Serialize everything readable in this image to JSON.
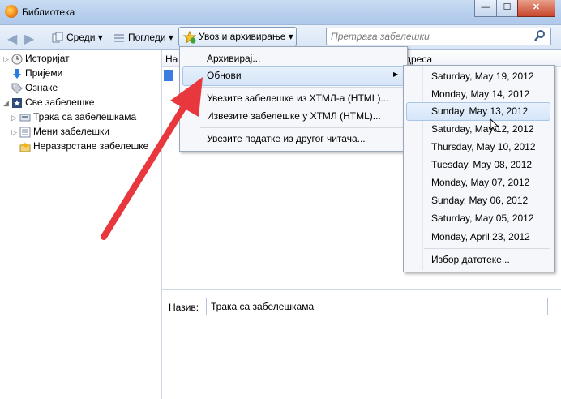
{
  "window": {
    "title": "Библиотека",
    "minimize": "—",
    "maximize": "☐",
    "close": "✕"
  },
  "toolbar": {
    "organize_label": "Среди ▾",
    "views_label": "Погледи ▾",
    "import_label": "Увоз и архивирање ▾",
    "search_placeholder": "Претрага забелешки"
  },
  "sidebar": {
    "items": [
      {
        "label": "Историјат",
        "icon": "history-icon"
      },
      {
        "label": "Пријеми",
        "icon": "downloads-icon"
      },
      {
        "label": "Ознаке",
        "icon": "tags-icon"
      },
      {
        "label": "Све забелешке",
        "icon": "all-bookmarks-icon"
      },
      {
        "label": "Трака са забелешкама",
        "icon": "bookmarks-toolbar-icon"
      },
      {
        "label": "Мени забелешки",
        "icon": "bookmarks-menu-icon"
      },
      {
        "label": "Неразврстане забелешке",
        "icon": "unsorted-bookmarks-icon"
      }
    ]
  },
  "content": {
    "column_left": "На",
    "column_right": "дреса"
  },
  "details": {
    "name_label": "Назив:",
    "name_value": "Трака са забелешкама"
  },
  "import_menu": {
    "backup": "Архивирај...",
    "restore": "Обнови",
    "import_html": "Увезите забелешке из ХТМЛ-а (HTML)...",
    "export_html": "Извезите забелешке у ХТМЛ (HTML)...",
    "import_other": "Увезите податке из другог читача..."
  },
  "restore_menu": {
    "dates": [
      "Saturday, May 19, 2012",
      "Monday, May 14, 2012",
      "Sunday, May 13, 2012",
      "Saturday, May 12, 2012",
      "Thursday, May 10, 2012",
      "Tuesday, May 08, 2012",
      "Monday, May 07, 2012",
      "Sunday, May 06, 2012",
      "Saturday, May 05, 2012",
      "Monday, April 23, 2012"
    ],
    "choose_file": "Избор датотеке..."
  },
  "colors": {
    "highlight": "#d4e5f8",
    "annotation_arrow": "#e8383d"
  }
}
